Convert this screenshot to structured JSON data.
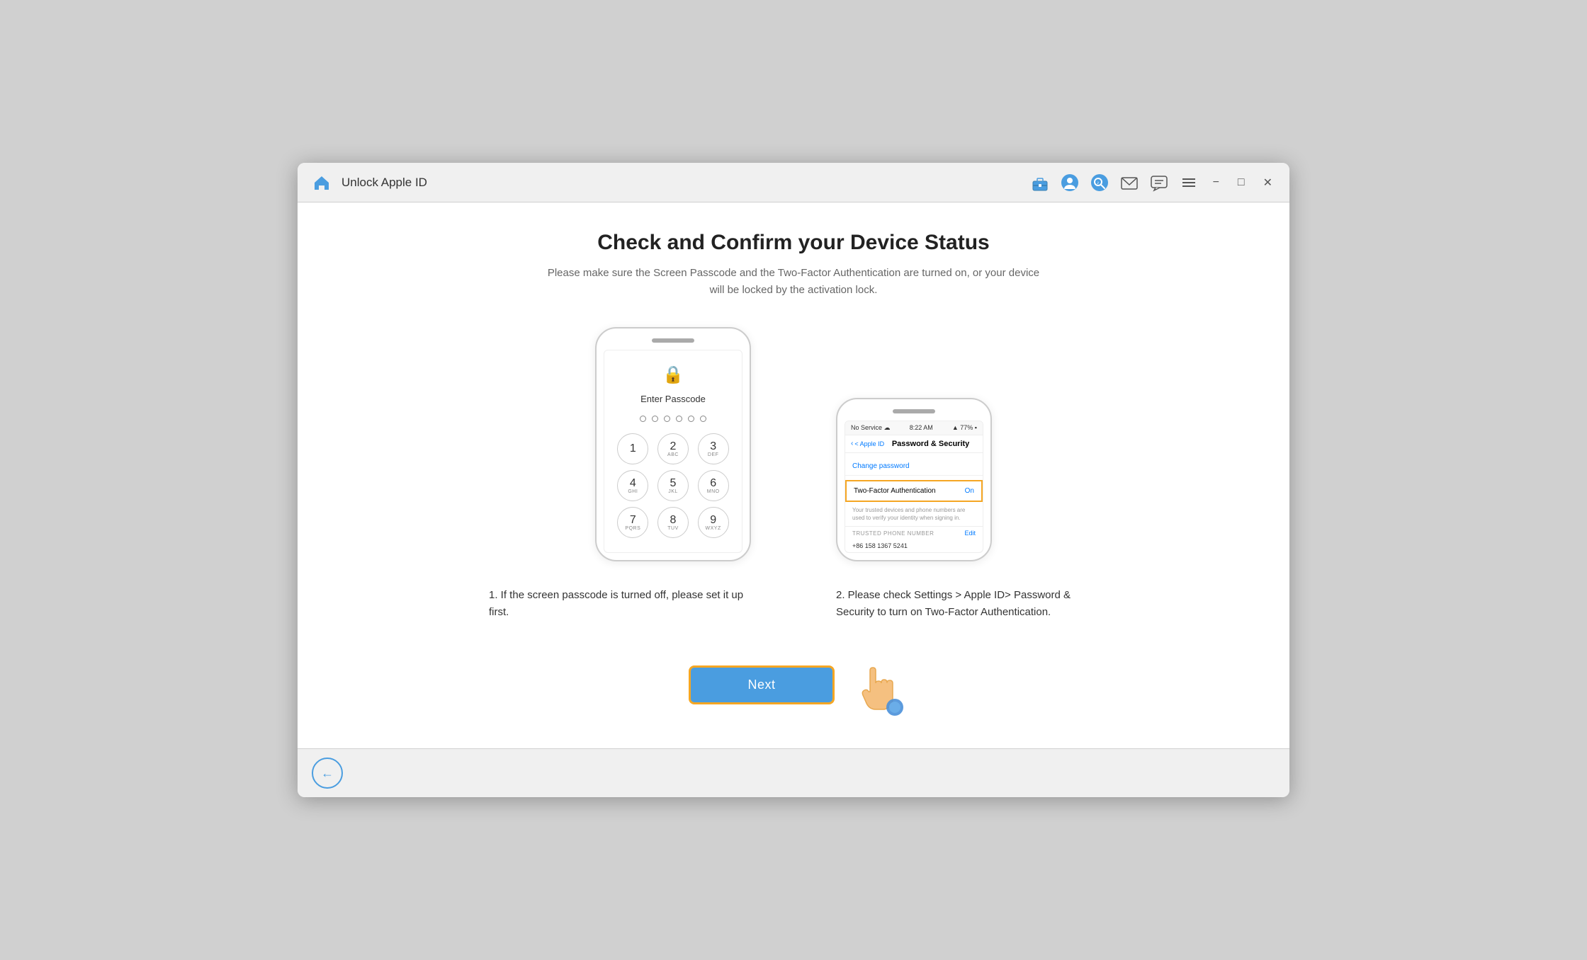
{
  "titleBar": {
    "title": "Unlock Apple ID",
    "icons": [
      "toolbox-icon",
      "user-icon",
      "search-icon",
      "mail-icon",
      "chat-icon",
      "menu-icon"
    ],
    "windowControls": [
      "minimize",
      "maximize",
      "close"
    ]
  },
  "main": {
    "heading": "Check and Confirm your Device Status",
    "subtitle": "Please make sure the Screen Passcode and the Two-Factor Authentication are turned on, or your device will be locked by the activation lock.",
    "phone1": {
      "screen": {
        "lockIcon": "🔒",
        "enterPasscodeLabel": "Enter Passcode",
        "keys": [
          {
            "num": "1",
            "letters": ""
          },
          {
            "num": "2",
            "letters": "ABC"
          },
          {
            "num": "3",
            "letters": "DEF"
          },
          {
            "num": "4",
            "letters": "GHI"
          },
          {
            "num": "5",
            "letters": "JKL"
          },
          {
            "num": "6",
            "letters": "MNO"
          },
          {
            "num": "7",
            "letters": "PQRS"
          },
          {
            "num": "8",
            "letters": "TUV"
          },
          {
            "num": "9",
            "letters": "WXYZ"
          }
        ]
      }
    },
    "phone2": {
      "screen": {
        "statusBar": {
          "left": "No Service ☁",
          "center": "8:22 AM",
          "right": "▲ 77%"
        },
        "navBack": "< Apple ID",
        "navTitle": "Password & Security",
        "changePassword": "Change password",
        "twoFactorLabel": "Two-Factor Authentication",
        "twoFactorValue": "On",
        "smallText": "Your trusted devices and phone numbers are used to verify your identity when signing in.",
        "trustedLabel": "TRUSTED PHONE NUMBER",
        "editLabel": "Edit",
        "phoneNumber": "+86 158 1367 5241"
      }
    },
    "desc1": "1. If the screen passcode is turned off, please set it up first.",
    "desc2": "2. Please check Settings > Apple ID> Password & Security to turn on Two-Factor Authentication.",
    "nextButton": "Next",
    "backButton": "←"
  }
}
